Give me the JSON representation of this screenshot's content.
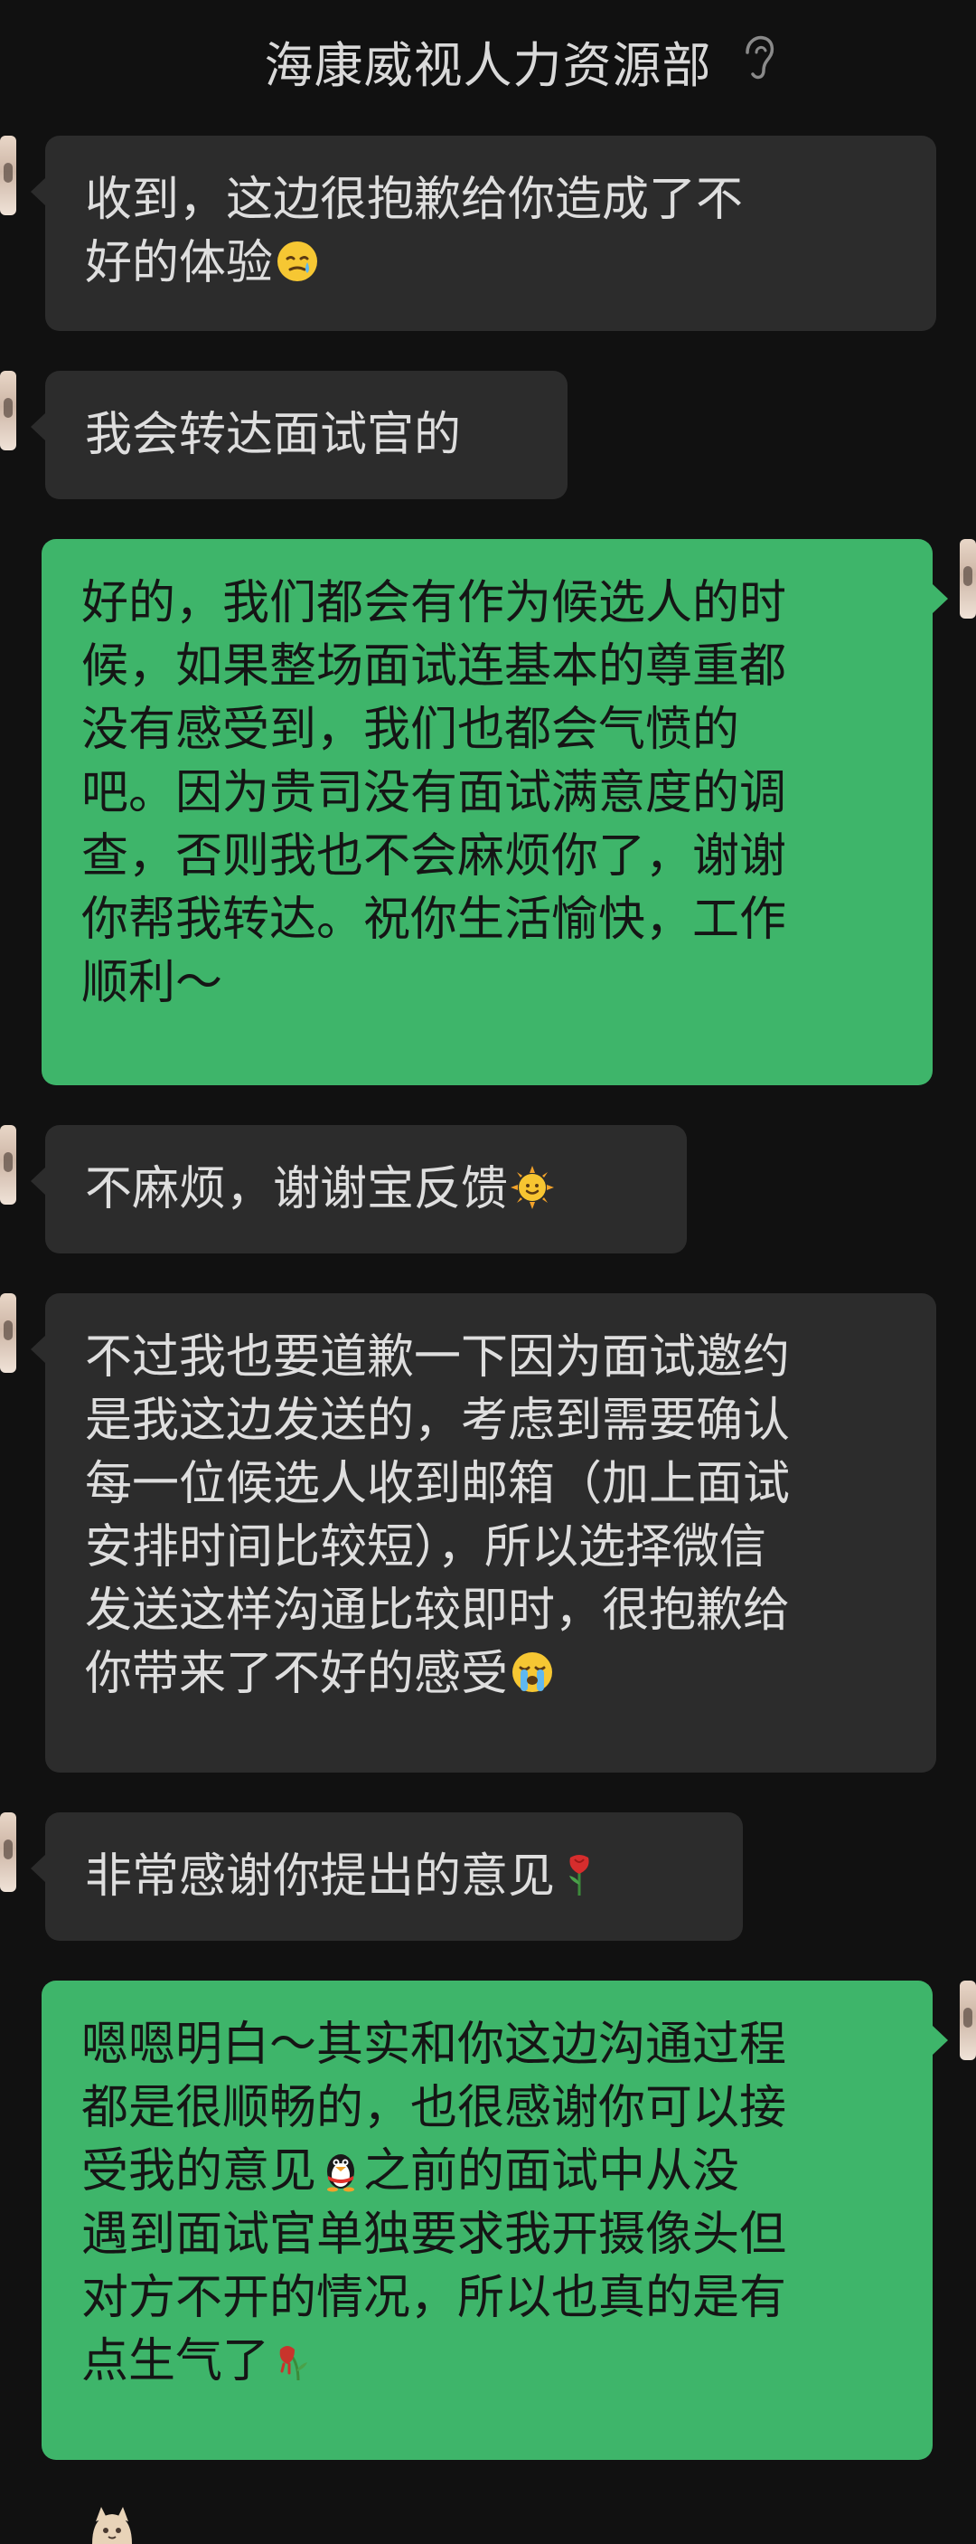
{
  "header": {
    "title": "海康威视人力资源部",
    "icon": "ear-icon"
  },
  "messages": [
    {
      "side": "in",
      "text": "收到，这边很抱歉给你造成了不\n好的体验",
      "emoji": "crying-smile-emoji-icon"
    },
    {
      "side": "in",
      "text": "我会转达面试官的"
    },
    {
      "side": "out",
      "text": "好的，我们都会有作为候选人的时\n候，如果整场面试连基本的尊重都\n没有感受到，我们也都会气愤的\n吧。因为贵司没有面试满意度的调\n查，否则我也不会麻烦你了，谢谢\n你帮我转达。祝你生活愉快，工作\n顺利～"
    },
    {
      "side": "in",
      "text": "不麻烦，谢谢宝反馈",
      "emoji": "sun-emoji-icon"
    },
    {
      "side": "in",
      "text": "不过我也要道歉一下因为面试邀约\n是我这边发送的，考虑到需要确认\n每一位候选人收到邮箱（加上面试\n安排时间比较短），所以选择微信\n发送这样沟通比较即时，很抱歉给\n你带来了不好的感受",
      "emoji": "loudly-crying-emoji-icon"
    },
    {
      "side": "in",
      "text": "非常感谢你提出的意见",
      "emoji": "rose-emoji-icon"
    },
    {
      "side": "out",
      "text": "嗯嗯明白～其实和你这边沟通过程\n都是很顺畅的，也很感谢你可以接\n受我的意见",
      "emoji": "penguin-emoji-icon",
      "text_after": "之前的面试中从没\n遇到面试官单独要求我开摄像头但\n对方不开的情况，所以也真的是有\n点生气了",
      "emoji_end": "wilted-flower-emoji-icon"
    }
  ],
  "colors": {
    "background": "#111111",
    "incoming_bubble": "#2c2c2c",
    "outgoing_bubble": "#3eb56a"
  }
}
